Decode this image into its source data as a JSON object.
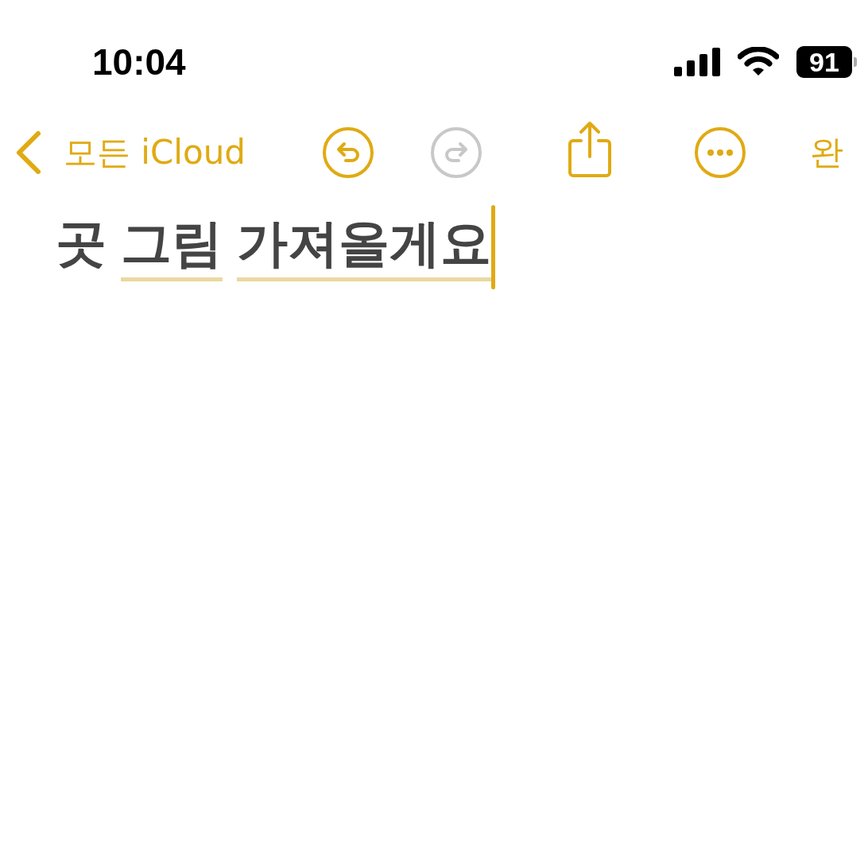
{
  "status_bar": {
    "time": "10:04",
    "battery": "91"
  },
  "toolbar": {
    "back_label": "모든 iCloud",
    "undo_enabled": true,
    "redo_enabled": false,
    "done_label": "완"
  },
  "note": {
    "words": [
      {
        "text": "곳",
        "underlined": false
      },
      {
        "text": "그림",
        "underlined": true
      },
      {
        "text": "가져올게요",
        "underlined": true
      }
    ],
    "cursor": true
  }
}
